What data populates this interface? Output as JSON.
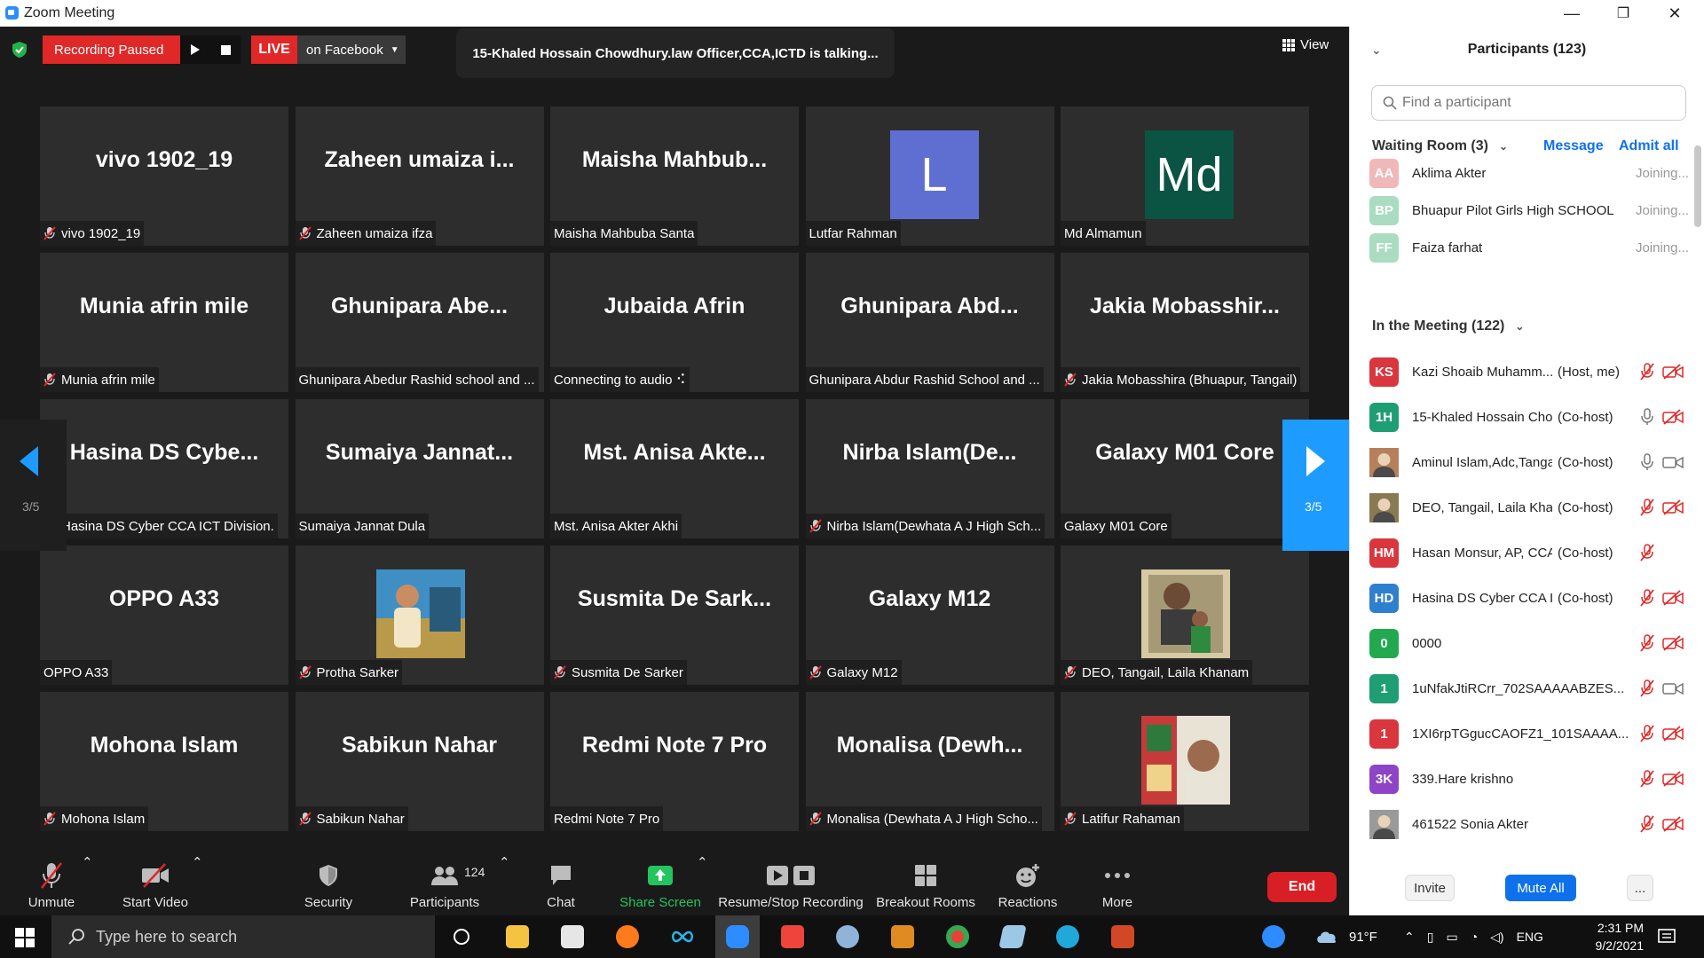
{
  "window": {
    "title": "Zoom Meeting",
    "minimize": "—",
    "restore": "❐",
    "close": "✕"
  },
  "recording": {
    "status": "Recording Paused",
    "live_label": "LIVE",
    "live_target": "on Facebook"
  },
  "talking_banner": "15-Khaled Hossain Chowdhury.law Officer,CCA,ICTD is talking...",
  "view_label": "View",
  "pager": {
    "prev_page": "3/5",
    "next_page": "3/5"
  },
  "tiles": [
    {
      "big": "vivo 1902_19",
      "label": "vivo 1902_19",
      "muted": true
    },
    {
      "big": "Zaheen umaiza i...",
      "label": "Zaheen umaiza ifza",
      "muted": true
    },
    {
      "big": "Maisha Mahbub...",
      "label": "Maisha Mahbuba Santa",
      "muted": false
    },
    {
      "avatar": "L",
      "avatar_color": "#5f6fd1",
      "label": "Lutfar Rahman",
      "muted": false
    },
    {
      "avatar": "Md",
      "avatar_color": "#0b5443",
      "label": "Md Almamun",
      "muted": false
    },
    {
      "big": "Munia afrin mile",
      "label": "Munia afrin mile",
      "muted": true
    },
    {
      "big": "Ghunipara Abe...",
      "label": "Ghunipara Abedur Rashid school and ...",
      "muted": false
    },
    {
      "big": "Jubaida Afrin",
      "label": "Connecting to audio ⠪",
      "muted": false
    },
    {
      "big": "Ghunipara Abd...",
      "label": "Ghunipara Abdur Rashid School and ...",
      "muted": false
    },
    {
      "big": "Jakia Mobasshir...",
      "label": "Jakia Mobasshira (Bhuapur, Tangail)",
      "muted": true
    },
    {
      "big": "Hasina DS Cybe...",
      "label": "Hasina DS Cyber CCA ICT Division.",
      "muted": true
    },
    {
      "big": "Sumaiya Jannat...",
      "label": "Sumaiya Jannat Dula",
      "muted": false
    },
    {
      "big": "Mst. Anisa Akte...",
      "label": "Mst. Anisa Akter Akhi",
      "muted": false
    },
    {
      "big": "Nirba Islam(De...",
      "label": "Nirba Islam(Dewhata A J High Sch...",
      "muted": true
    },
    {
      "big": "Galaxy M01 Core",
      "label": "Galaxy M01 Core",
      "muted": false
    },
    {
      "big": "OPPO A33",
      "label": "OPPO A33",
      "muted": false
    },
    {
      "photo": "boy-aquarium-photo",
      "label": "Protha Sarker",
      "muted": true
    },
    {
      "big": "Susmita De Sark...",
      "label": "Susmita De Sarker",
      "muted": true
    },
    {
      "big": "Galaxy M12",
      "label": "Galaxy M12",
      "muted": true
    },
    {
      "photo": "portrait-painting-photo",
      "label": "DEO, Tangail, Laila Khanam",
      "muted": true
    },
    {
      "big": "Mohona Islam",
      "label": "Mohona Islam",
      "muted": true
    },
    {
      "big": "Sabikun Nahar",
      "label": "Sabikun Nahar",
      "muted": true
    },
    {
      "big": "Redmi Note 7 Pro",
      "label": "Redmi Note 7 Pro",
      "muted": false
    },
    {
      "big": "Monalisa (Dewh...",
      "label": "Monalisa (Dewhata A J High Scho...",
      "muted": true
    },
    {
      "photo": "man-poster-photo",
      "label": "Latifur Rahaman",
      "muted": true
    }
  ],
  "toolbar": {
    "unmute": "Unmute",
    "start_video": "Start Video",
    "security": "Security",
    "participants": "Participants",
    "participants_count": "124",
    "chat": "Chat",
    "share_screen": "Share Screen",
    "recording": "Resume/Stop Recording",
    "breakout": "Breakout Rooms",
    "reactions": "Reactions",
    "more": "More",
    "end": "End"
  },
  "panel": {
    "title": "Participants (123)",
    "search_placeholder": "Find a participant",
    "waiting_title": "Waiting Room (3)",
    "message": "Message",
    "admit_all": "Admit all",
    "waiting": [
      {
        "initials": "AA",
        "color": "#f0b8b8",
        "name": "Aklima Akter",
        "status": "Joining..."
      },
      {
        "initials": "BP",
        "color": "#a9dcc0",
        "name": "Bhuapur Pilot Girls High SCHOOL",
        "status": "Joining..."
      },
      {
        "initials": "FF",
        "color": "#a9dcc0",
        "name": "Faiza farhat",
        "status": "Joining..."
      }
    ],
    "meeting_title": "In the Meeting (122)",
    "members": [
      {
        "initials": "KS",
        "color": "#d9363e",
        "name": "Kazi Shoaib Muhamm...",
        "role": "(Host, me)",
        "mic": "muted",
        "video": "off"
      },
      {
        "initials": "1H",
        "color": "#1f9e73",
        "name": "15-Khaled Hossain Cho...",
        "role": "(Co-host)",
        "mic": "on",
        "video": "off"
      },
      {
        "initials": "",
        "color": "#b5805a",
        "name": "Aminul Islam,Adc,Tangail",
        "role": "(Co-host)",
        "mic": "on",
        "video": "on"
      },
      {
        "initials": "",
        "color": "#8a7a52",
        "name": "DEO, Tangail, Laila Kha...",
        "role": "(Co-host)",
        "mic": "muted",
        "video": "off"
      },
      {
        "initials": "HM",
        "color": "#d9363e",
        "name": "Hasan Monsur, AP, CCA",
        "role": "(Co-host)",
        "mic": "muted",
        "video": ""
      },
      {
        "initials": "HD",
        "color": "#2f7fcf",
        "name": "Hasina DS Cyber CCA I...",
        "role": "(Co-host)",
        "mic": "muted",
        "video": "off"
      },
      {
        "initials": "0",
        "color": "#22a94f",
        "name": "0000",
        "role": "",
        "mic": "muted",
        "video": "off"
      },
      {
        "initials": "1",
        "color": "#1f9e73",
        "name": "1uNfakJtiRCrr_702SAAAAABZES...",
        "role": "",
        "mic": "muted",
        "video": "on"
      },
      {
        "initials": "1",
        "color": "#d9363e",
        "name": "1XI6rpTGgucCAOFZ1_101SAAAA...",
        "role": "",
        "mic": "muted",
        "video": "off"
      },
      {
        "initials": "3K",
        "color": "#8e44c7",
        "name": "339.Hare krishno",
        "role": "",
        "mic": "muted",
        "video": "off"
      },
      {
        "initials": "",
        "color": "#9a9a9a",
        "name": "461522 Sonia Akter",
        "role": "",
        "mic": "muted",
        "video": "off"
      }
    ],
    "invite": "Invite",
    "mute_all": "Mute All",
    "more": "..."
  },
  "taskbar": {
    "search_placeholder": "Type here to search",
    "weather": "91°F",
    "language": "ENG",
    "time": "2:31 PM",
    "date": "9/2/2021"
  },
  "colors": {
    "live_red": "#e02828",
    "zoom_blue": "#2d8cff",
    "share_green": "#22c55e",
    "end_red": "#d91f26",
    "link_blue": "#0e71eb"
  }
}
